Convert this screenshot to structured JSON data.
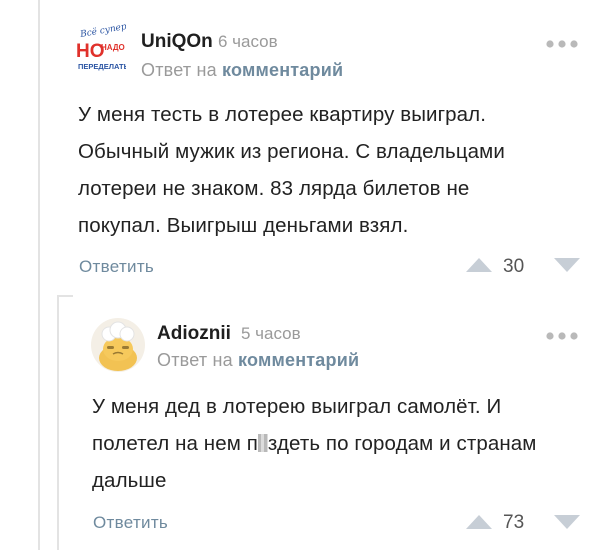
{
  "comments": [
    {
      "author": "UniQOn",
      "time": "6 часов",
      "reply_prefix": "Ответ на",
      "reply_link": "комментарий",
      "text_lines": [
        "У меня тесть в лотерее квартиру выиграл.",
        "Обычный мужик из региона. С владельцами",
        "лотереи не знаком. 83 лярда билетов не",
        "покупал. Выигрыш деньгами взял."
      ],
      "reply_label": "Ответить",
      "score": "30",
      "avatar_logo": {
        "line1": "Всё супер!",
        "line2": "НО",
        "line3": "НАДО",
        "line4": "ПЕРЕДЕЛАТЬ"
      }
    },
    {
      "author": "Adioznii",
      "time": "5 часов",
      "reply_prefix": "Ответ на",
      "reply_link": "комментарий",
      "text_line1": "У меня дед в лотерею выиграл самолёт. И",
      "text_line2_before": "полетел на нем п",
      "text_line2_after": "здеть по городам и странам",
      "text_line3": "дальше",
      "reply_label": "Ответить",
      "score": "73"
    }
  ],
  "colors": {
    "link": "#6f8a9e",
    "muted": "#9a9a9a",
    "vote_arrow": "#c7ced6",
    "thread_line": "#e3e3e3"
  },
  "icons": [
    "more-dots-icon",
    "upvote-arrow-icon",
    "downvote-arrow-icon",
    "avatar-logo",
    "avatar-cartoon"
  ]
}
